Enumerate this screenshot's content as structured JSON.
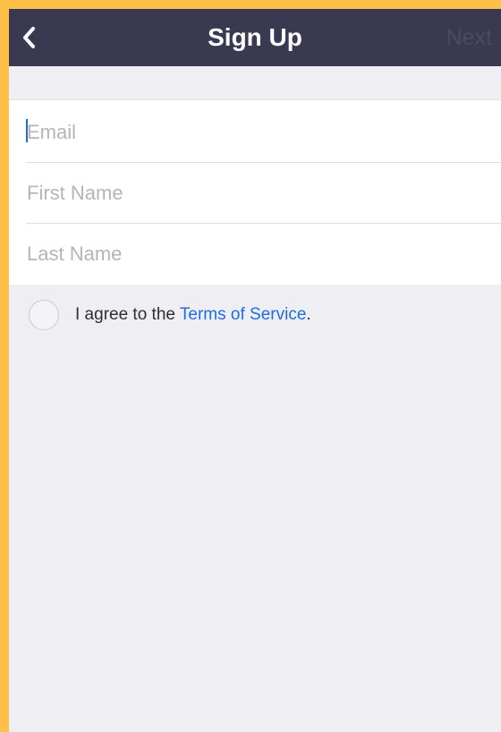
{
  "navbar": {
    "title": "Sign Up",
    "back_icon": "chevron-left-icon",
    "next_label": "Next"
  },
  "form": {
    "email_placeholder": "Email",
    "first_name_placeholder": "First Name",
    "last_name_placeholder": "Last Name"
  },
  "terms": {
    "prefix": "I agree to the ",
    "link_label": "Terms of Service",
    "suffix": "."
  },
  "colors": {
    "navbar_bg": "#393951",
    "accent": "#1F6CE6",
    "page_bg": "#EEEEF3",
    "frame": "#FFC04A"
  }
}
